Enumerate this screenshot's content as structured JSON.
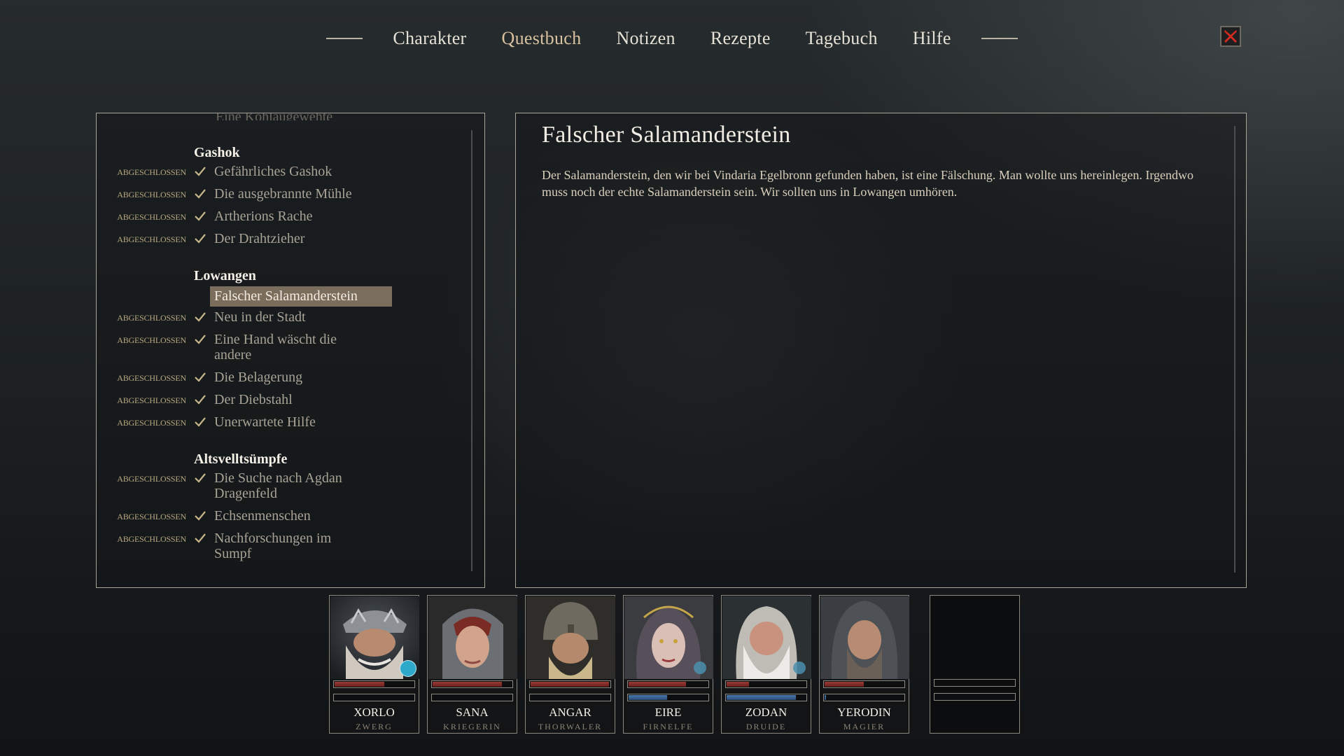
{
  "nav": {
    "tabs": [
      {
        "label": "Charakter"
      },
      {
        "label": "Questbuch"
      },
      {
        "label": "Notizen"
      },
      {
        "label": "Rezepte"
      },
      {
        "label": "Tagebuch"
      },
      {
        "label": "Hilfe"
      }
    ],
    "active_tab": "Questbuch",
    "close_icon": "close-x-icon"
  },
  "quest_list": {
    "cut_off_title": "Eine Kohlaugewehte",
    "groups": [
      {
        "region": "Gashok",
        "quests": [
          {
            "status": "ABGESCHLOSSEN",
            "title": "Gefährliches Gashok"
          },
          {
            "status": "ABGESCHLOSSEN",
            "title": "Die ausgebrannte Mühle"
          },
          {
            "status": "ABGESCHLOSSEN",
            "title": "Artherions Rache"
          },
          {
            "status": "ABGESCHLOSSEN",
            "title": "Der Drahtzieher"
          }
        ]
      },
      {
        "region": "Lowangen",
        "quests": [
          {
            "status": "",
            "title": "Falscher Salamanderstein",
            "selected": true
          },
          {
            "status": "ABGESCHLOSSEN",
            "title": "Neu in der Stadt"
          },
          {
            "status": "ABGESCHLOSSEN",
            "title": "Eine Hand wäscht die andere"
          },
          {
            "status": "ABGESCHLOSSEN",
            "title": "Die Belagerung"
          },
          {
            "status": "ABGESCHLOSSEN",
            "title": "Der Diebstahl"
          },
          {
            "status": "ABGESCHLOSSEN",
            "title": "Unerwartete Hilfe"
          }
        ]
      },
      {
        "region": "Altsvelltsümpfe",
        "quests": [
          {
            "status": "ABGESCHLOSSEN",
            "title": "Die Suche nach Agdan Dragenfeld"
          },
          {
            "status": "ABGESCHLOSSEN",
            "title": "Echsenmenschen"
          },
          {
            "status": "ABGESCHLOSSEN",
            "title": "Nachforschungen im Sumpf"
          }
        ]
      }
    ]
  },
  "detail": {
    "title": "Falscher Salamanderstein",
    "text": "Der Salamanderstein, den wir bei Vindaria Egelbronn gefunden haben, ist eine Fälschung. Man wollte uns hereinlegen. Irgendwo muss noch der echte Salamanderstein sein. Wir sollten uns in Lowangen umhören."
  },
  "party": [
    {
      "name": "XORLO",
      "class": "ZWERG",
      "hp": 0.62,
      "mp": null,
      "badge": "armor-icon"
    },
    {
      "name": "SANA",
      "class": "KRIEGERIN",
      "hp": 0.86,
      "mp": null,
      "badge": null
    },
    {
      "name": "ANGAR",
      "class": "THORWALER",
      "hp": 0.97,
      "mp": null,
      "badge": null
    },
    {
      "name": "EIRE",
      "class": "FIRNELFE",
      "hp": 0.71,
      "mp": 0.48,
      "badge": "water-icon"
    },
    {
      "name": "ZODAN",
      "class": "DRUIDE",
      "hp": 0.28,
      "mp": 0.86,
      "badge": "water-icon"
    },
    {
      "name": "YERODIN",
      "class": "MAGIER",
      "hp": 0.49,
      "mp": 0.02,
      "badge": null
    },
    {
      "name": "",
      "class": "",
      "hp": 0,
      "mp": 0,
      "badge": null
    }
  ],
  "colors": {
    "accent_tab": "#d8c2a0",
    "status_text": "#b8a882",
    "selected_row": "#7b6d5c",
    "hp_bar": "#9c3b36",
    "mp_bar": "#4a7ab0",
    "close_x": "#d42a20"
  }
}
